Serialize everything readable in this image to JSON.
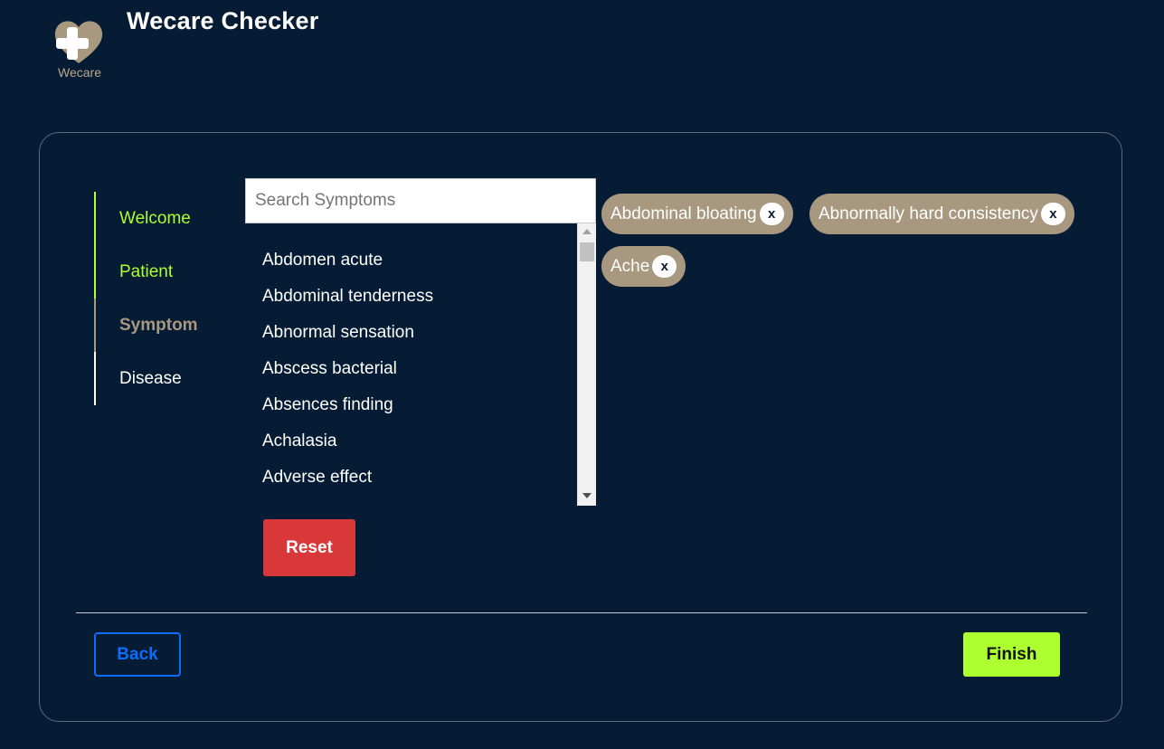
{
  "header": {
    "logo_text": "Wecare",
    "title": "Wecare Checker"
  },
  "steps": [
    {
      "label": "Welcome",
      "state": "done"
    },
    {
      "label": "Patient",
      "state": "done"
    },
    {
      "label": "Symptom",
      "state": "current"
    },
    {
      "label": "Disease",
      "state": "todo"
    }
  ],
  "search": {
    "placeholder": "Search Symptoms",
    "value": ""
  },
  "symptom_list": [
    "Abdomen acute",
    "Abdominal tenderness",
    "Abnormal sensation",
    "Abscess bacterial",
    "Absences finding",
    "Achalasia",
    "Adverse effect"
  ],
  "selected_symptoms": [
    {
      "label": "Abdominal bloating",
      "remove": "x"
    },
    {
      "label": "Abnormally hard consistency",
      "remove": "x"
    },
    {
      "label": "Ache",
      "remove": "x"
    }
  ],
  "buttons": {
    "reset": "Reset",
    "back": "Back",
    "finish": "Finish"
  },
  "colors": {
    "background": "#061b34",
    "accent_green": "#adff2f",
    "accent_tan": "#a89880",
    "reset_red": "#d9383a",
    "back_blue": "#0d6efd"
  }
}
